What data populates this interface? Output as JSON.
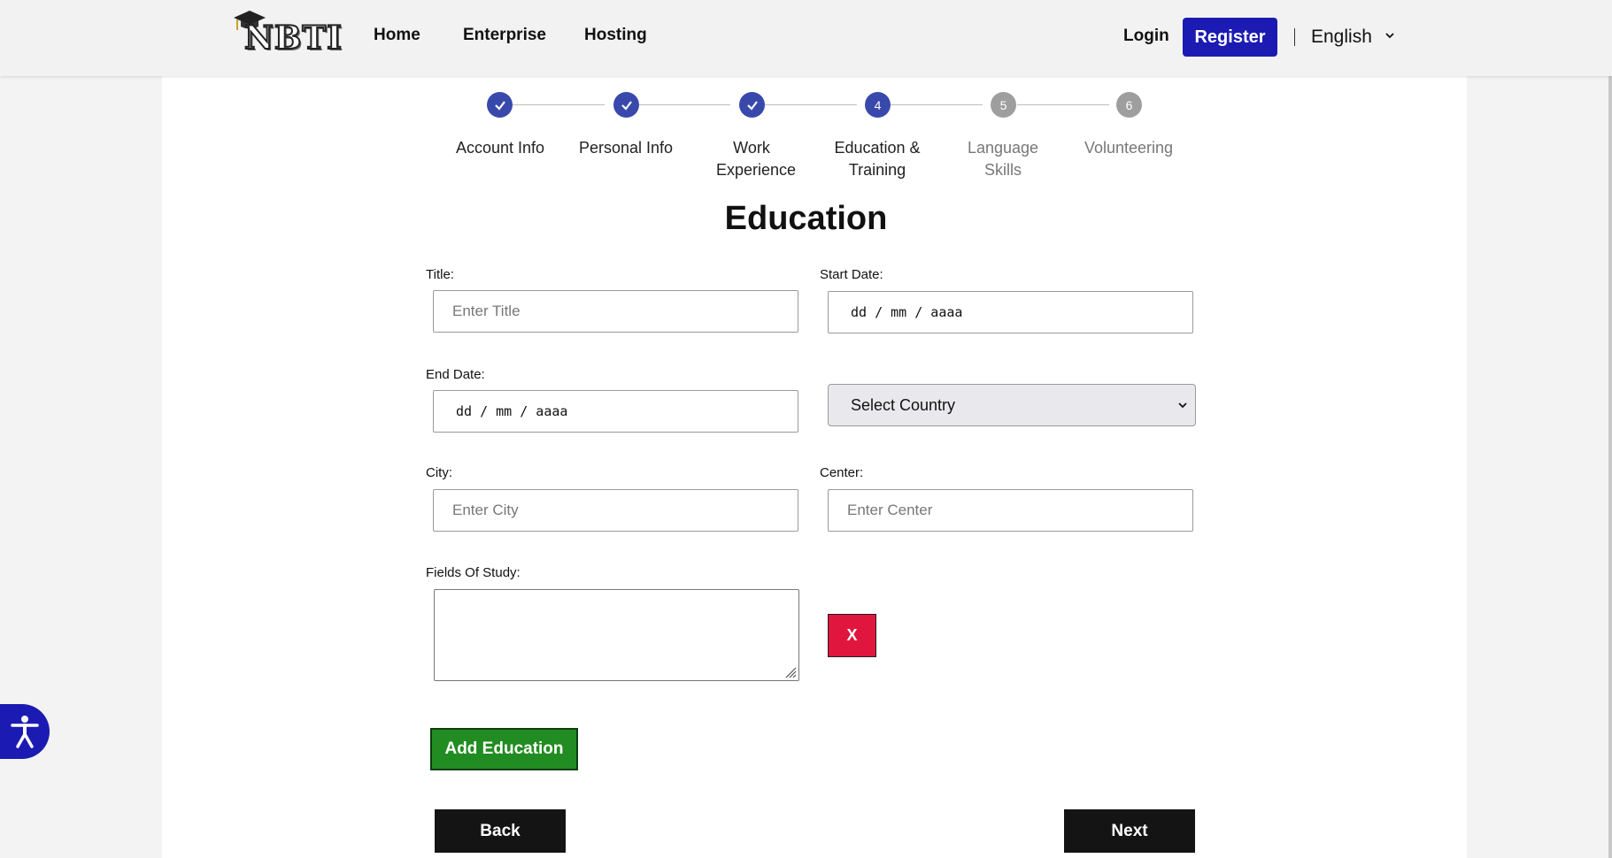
{
  "header": {
    "logo_text": "NBTI",
    "nav": [
      "Home",
      "Enterprise",
      "Hosting"
    ],
    "login_label": "Login",
    "register_label": "Register",
    "language": "English"
  },
  "stepper": {
    "steps": [
      {
        "number": "1",
        "label": "Account Info",
        "status": "done"
      },
      {
        "number": "2",
        "label": "Personal Info",
        "status": "done"
      },
      {
        "number": "3",
        "label": "Work Experience",
        "status": "done"
      },
      {
        "number": "4",
        "label": "Education & Training",
        "status": "active"
      },
      {
        "number": "5",
        "label": "Language Skills",
        "status": "pending"
      },
      {
        "number": "6",
        "label": "Volunteering",
        "status": "pending"
      }
    ]
  },
  "form": {
    "section_title": "Education",
    "title_label": "Title:",
    "title_placeholder": "Enter Title",
    "start_date_label": "Start Date:",
    "start_date_value": "dd / mm / aaaa",
    "end_date_label": "End Date:",
    "end_date_value": "dd / mm / aaaa",
    "country_value": "Select Country",
    "city_label": "City:",
    "city_placeholder": "Enter City",
    "center_label": "Center:",
    "center_placeholder": "Enter Center",
    "fields_label": "Fields Of Study:",
    "remove_label": "X",
    "add_label": "Add Education",
    "back_label": "Back",
    "next_label": "Next"
  },
  "colors": {
    "brand_blue": "#1b1bb3",
    "step_blue": "#3949ab",
    "step_gray": "#9e9e9e",
    "remove_red": "#e0163e",
    "add_green": "#218c21",
    "dark_button": "#141414"
  },
  "icons": [
    "graduation-cap-icon",
    "chevron-down-icon",
    "check-icon",
    "resize-handle-icon",
    "accessibility-icon"
  ]
}
